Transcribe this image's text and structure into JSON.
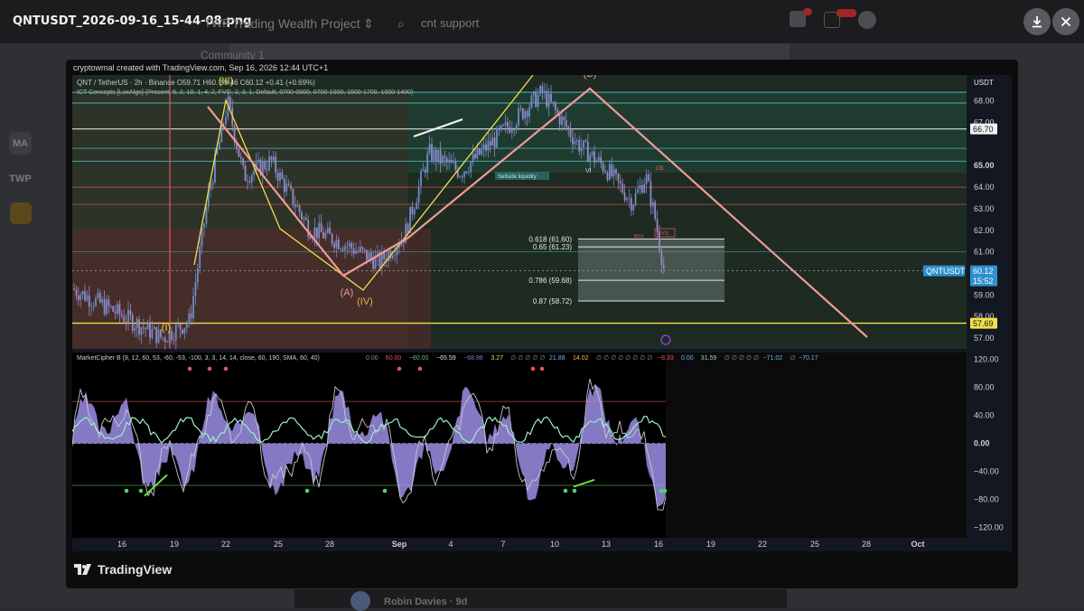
{
  "window": {
    "filename": "QNTUSDT_2026-09-16_15-44-08.png"
  },
  "background_app": {
    "brand": "TWP",
    "project_name": "Trading Wealth Project",
    "search_text": "cnt support",
    "community_label": "Community 1",
    "bottom_user": "Robin Davies",
    "bottom_user_time": "9d",
    "side_labels": [
      "MA",
      "TWP"
    ]
  },
  "viewer": {
    "download_icon": "download-icon",
    "close_icon": "close-icon",
    "caption": "cryptowmal created with TradingView.com, Sep 16, 2026 12:44 UTC+1",
    "logo_text": "TradingView"
  },
  "chart_data": {
    "type": "candlestick",
    "symbol_line": "QNT / TetherUS · 2h · Binance",
    "ohlc": {
      "o": "O59.71",
      "h": "H60.",
      "l": "59.46",
      "c": "C60.12",
      "change": "+0.41 (+0.69%)"
    },
    "indicator_line": "ICT Concepts [LuxAlgo] (Present, 5, 2, 10, 1, 4, 2, FVG, 2, 3, 1, Default, 0700-0900, 0700-1000, 1500-1700, 1000-1400)",
    "currency": "USDT",
    "price_ticks": [
      "68.00",
      "67.00",
      "65.00",
      "64.00",
      "63.00",
      "62.00",
      "61.00",
      "59.00",
      "58.00",
      "57.00"
    ],
    "price_range": [
      56.5,
      69.2
    ],
    "price_labels": [
      {
        "text": "66.70",
        "value": 66.7,
        "style": "white"
      },
      {
        "text": "QNTUSDT",
        "value": 60.12,
        "style": "symbol"
      },
      {
        "text": "60.12",
        "value": 60.12,
        "style": "price"
      },
      {
        "text": "15:52",
        "value": 59.6,
        "style": "timer"
      },
      {
        "text": "57.69",
        "value": 57.69,
        "style": "yellow"
      }
    ],
    "fib_levels": [
      {
        "label": "0.618 (61.60)",
        "value": 61.6
      },
      {
        "label": "0.65 (61.23)",
        "value": 61.23
      },
      {
        "label": "0.786 (59.68)",
        "value": 59.68
      },
      {
        "label": "0.87 (58.72)",
        "value": 58.72
      }
    ],
    "wave_labels": [
      "(III)",
      "(A)",
      "(IV)",
      "(I)",
      "(B)"
    ],
    "annotations": [
      "Sellside liquidity",
      "VI",
      "OB",
      "FVG",
      "BOS"
    ],
    "x_ticks": [
      "16",
      "19",
      "22",
      "25",
      "28",
      "Sep",
      "4",
      "7",
      "10",
      "13",
      "16",
      "19",
      "22",
      "25",
      "28",
      "Oct"
    ],
    "oscillator": {
      "name": "MarketCipher B",
      "params": "(9, 12, 60, 53, -60, -53, -100, 3, 3, 14, 14, close, 60, 190, SMA, 60, 40)",
      "values": [
        {
          "text": "0.00",
          "color": "#8f8f8f"
        },
        {
          "text": "60.00",
          "color": "#ef5350"
        },
        {
          "text": "−60.00",
          "color": "#66bb6a"
        },
        {
          "text": "−65.59",
          "color": "#e0e0e0"
        },
        {
          "text": "−68.86",
          "color": "#9575cd"
        },
        {
          "text": "3.27",
          "color": "#fdd835"
        },
        {
          "text": "∅ ∅ ∅ ∅ ∅",
          "color": "#8f8f8f"
        },
        {
          "text": "21.88",
          "color": "#64b5f6"
        },
        {
          "text": "14.02",
          "color": "#ffb74d"
        },
        {
          "text": "∅ ∅ ∅ ∅ ∅ ∅ ∅ ∅",
          "color": "#8f8f8f"
        },
        {
          "text": "−8.33",
          "color": "#ef5350"
        },
        {
          "text": "0.00",
          "color": "#64b5f6"
        },
        {
          "text": "31.59",
          "color": "#a5d6a7"
        },
        {
          "text": "∅ ∅ ∅ ∅ ∅",
          "color": "#8f8f8f"
        },
        {
          "text": "−71.02",
          "color": "#64b5f6"
        },
        {
          "text": "∅",
          "color": "#8f8f8f"
        },
        {
          "text": "−70.17",
          "color": "#64b5f6"
        }
      ],
      "ticks": [
        "120.00",
        "80.00",
        "40.00",
        "0.00",
        "−40.00",
        "−80.00",
        "−120.00"
      ],
      "range": [
        -135,
        130
      ]
    }
  }
}
